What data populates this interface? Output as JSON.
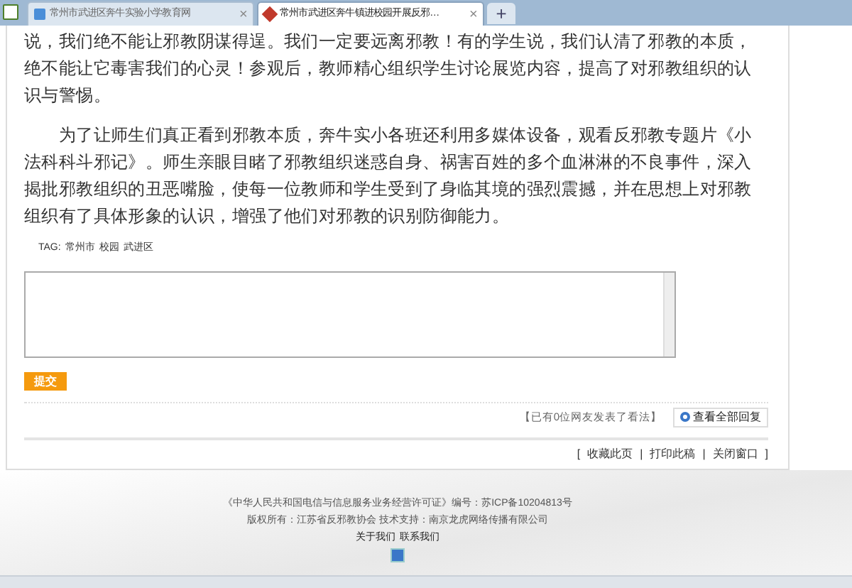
{
  "tabs": [
    {
      "label": "常州市武进区奔牛实验小学教育网",
      "selected": false,
      "close": "×"
    },
    {
      "label": "常州市武进区奔牛镇进校园开展反邪…",
      "selected": true,
      "close": "×"
    }
  ],
  "new_tab": "+",
  "article": {
    "paragraphs": [
      "说，我们绝不能让邪教阴谋得逞。我们一定要远离邪教！有的学生说，我们认清了邪教的本质，绝不能让它毒害我们的心灵！参观后，教师精心组织学生讨论展览内容，提高了对邪教组织的认识与警惕。",
      "为了让师生们真正看到邪教本质，奔牛实小各班还利用多媒体设备，观看反邪教专题片《小法科科斗邪记》。师生亲眼目睹了邪教组织迷惑自身、祸害百姓的多个血淋淋的不良事件，深入揭批邪教组织的丑恶嘴脸，使每一位教师和学生受到了身临其境的强烈震撼，并在思想上对邪教组织有了具体形象的认识，增强了他们对邪教的识别防御能力。"
    ],
    "tags_label": "TAG:",
    "tags": [
      "常州市",
      "校园",
      "武进区"
    ]
  },
  "comment": {
    "submit": "提交",
    "count_note": "【已有0位网友发表了看法】",
    "view_all": "查看全部回复"
  },
  "page_links": {
    "open": "[",
    "items": [
      "收藏此页",
      "打印此稿",
      "关闭窗口"
    ],
    "sep": "|",
    "close": "]"
  },
  "footer": {
    "lines": [
      "《中华人民共和国电信与信息服务业务经营许可证》编号：苏ICP备10204813号",
      "版权所有：江苏省反邪教协会 技术支持：南京龙虎网络传播有限公司"
    ],
    "links": [
      "关于我们",
      "联系我们"
    ]
  }
}
